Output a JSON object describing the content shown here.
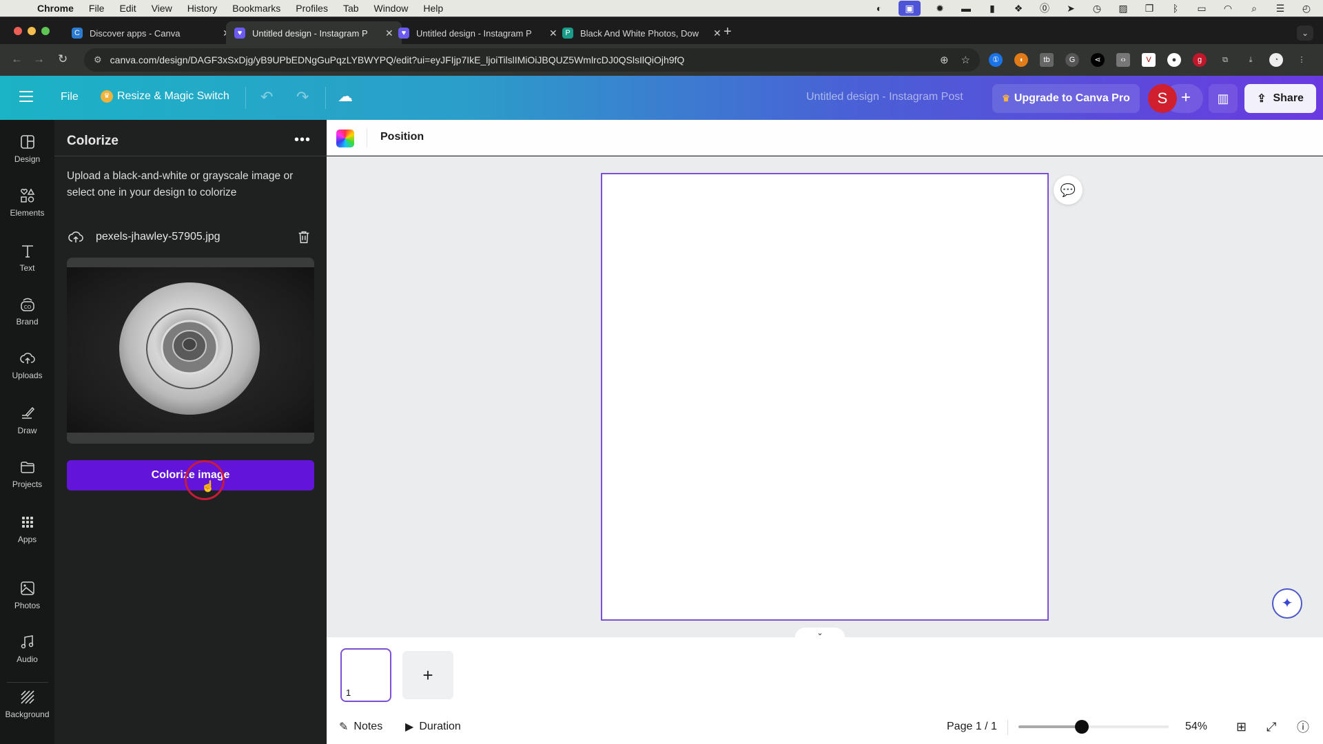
{
  "mac_menubar": {
    "app": "Chrome",
    "menus": [
      "File",
      "Edit",
      "View",
      "History",
      "Bookmarks",
      "Profiles",
      "Tab",
      "Window",
      "Help"
    ]
  },
  "browser": {
    "tabs": [
      {
        "title": "Discover apps - Canva",
        "active": false,
        "favicon_color": "#2a7bd1"
      },
      {
        "title": "Untitled design - Instagram P",
        "active": true,
        "favicon_color": "#6b5bf0"
      },
      {
        "title": "Untitled design - Instagram P",
        "active": false,
        "favicon_color": "#6b5bf0"
      },
      {
        "title": "Black And White Photos, Dow",
        "active": false,
        "favicon_color": "#1a9c8a"
      }
    ],
    "url": "canva.com/design/DAGF3xSxDjg/yB9UPbEDNgGuPqzLYBWYPQ/edit?ui=eyJFIjp7IkE_ljoiTilslIMiOiJBQUZ5WmlrcDJ0QSlsIlQiOjh9fQ"
  },
  "canva_header": {
    "file": "File",
    "resize": "Resize & Magic Switch",
    "design_title": "Untitled design - Instagram Post",
    "upgrade": "Upgrade to Canva Pro",
    "avatar_initial": "S",
    "share": "Share"
  },
  "rail": {
    "items": [
      {
        "label": "Design",
        "icon": "design-icon"
      },
      {
        "label": "Elements",
        "icon": "elements-icon"
      },
      {
        "label": "Text",
        "icon": "text-icon"
      },
      {
        "label": "Brand",
        "icon": "brand-icon"
      },
      {
        "label": "Uploads",
        "icon": "uploads-icon"
      },
      {
        "label": "Draw",
        "icon": "draw-icon"
      },
      {
        "label": "Projects",
        "icon": "projects-icon"
      },
      {
        "label": "Apps",
        "icon": "apps-icon"
      },
      {
        "label": "Photos",
        "icon": "photos-icon"
      },
      {
        "label": "Audio",
        "icon": "audio-icon"
      },
      {
        "label": "Background",
        "icon": "background-icon"
      }
    ]
  },
  "panel": {
    "title": "Colorize",
    "description": "Upload a black-and-white or grayscale image or select one in your design to colorize",
    "file_name": "pexels-jhawley-57905.jpg",
    "button": "Colorize image"
  },
  "context_toolbar": {
    "position": "Position"
  },
  "pages": {
    "thumb_number": "1",
    "add": "+"
  },
  "bottom_bar": {
    "notes": "Notes",
    "duration": "Duration",
    "page_indicator": "Page 1 / 1",
    "zoom": "54%",
    "zoom_slider_fraction": 0.42
  },
  "colors": {
    "accent": "#6214d9",
    "page_border": "#7d4fd3",
    "avatar": "#d0202e"
  }
}
